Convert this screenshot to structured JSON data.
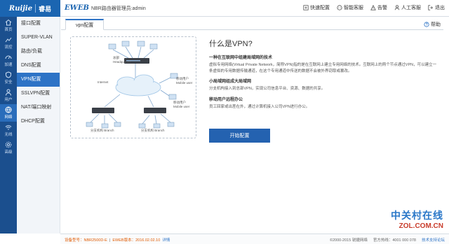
{
  "brand": {
    "name": "Ruijie",
    "sub": "睿易"
  },
  "header": {
    "eweb": "EWEB",
    "title": "NBR路由器管理员:admin"
  },
  "tools": [
    {
      "label": "快速配置",
      "icon": "quick-config-icon"
    },
    {
      "label": "智能客服",
      "icon": "chat-icon"
    },
    {
      "label": "告警",
      "icon": "alert-icon"
    },
    {
      "label": "人工客服",
      "icon": "person-icon"
    },
    {
      "label": "退出",
      "icon": "logout-icon"
    }
  ],
  "rail": [
    {
      "label": "首页",
      "icon": "home-icon"
    },
    {
      "label": "流控",
      "icon": "flow-icon"
    },
    {
      "label": "加速",
      "icon": "speed-icon"
    },
    {
      "label": "安全",
      "icon": "shield-icon"
    },
    {
      "label": "用户",
      "icon": "user-icon"
    },
    {
      "label": "网络",
      "icon": "globe-icon"
    },
    {
      "label": "无线",
      "icon": "wifi-icon"
    },
    {
      "label": "高级",
      "icon": "settings-icon"
    }
  ],
  "menu": [
    "接口配置",
    "SUPER-VLAN",
    "路由/负载",
    "DNS配置",
    "VPN配置",
    "SSLVPN配置",
    "NAT/端口映射",
    "DHCP配置"
  ],
  "tab": {
    "label": "vpn配置",
    "help": "帮助"
  },
  "diagram": {
    "hq": "总部",
    "hq_en": "Headquarter",
    "internet": "Internet",
    "mobile1": "移动用户",
    "mobile1_en": "Mobile user",
    "mobile2": "移动用户",
    "mobile2_en": "Mobile user",
    "branch1": "分支机构 Branch",
    "branch2": "分支机构 Branch"
  },
  "content": {
    "title": "什么是VPN?",
    "h1": "一种在互联网中组建局域网的技术",
    "p1": "虚拟专用网络(Virtual Private Network，简称VPN)指的是在互联网上建立专用网络的技术。互联网上的两个节点通过VPN，可以建立一条虚拟的专用数据传输通道，在这个专用通道中传送的数据不会被外界窃取或篡改。",
    "h2": "小局域网组成大局域网",
    "p2": "分支机构接入到总部VPN，实现公司信息平台、资源、数据的共享。",
    "h3": "移动用户远程办公",
    "p3": "员工回家或出差在外，通过计算机接入公司VPN进行办公。",
    "start_button": "开始配置"
  },
  "footer": {
    "model_label": "设备型号：",
    "model": "NBR2500D-E",
    "version_label": "EWEB版本：",
    "version": "2016.02.02.10",
    "details": "详情",
    "copyright": "©2000-2015 锐捷网络",
    "hotline": "官方热线：4001 000 078",
    "tech": "技术支持论坛"
  },
  "watermark": {
    "cn": "中关村在线",
    "en": "ZOL.COM.CN"
  }
}
